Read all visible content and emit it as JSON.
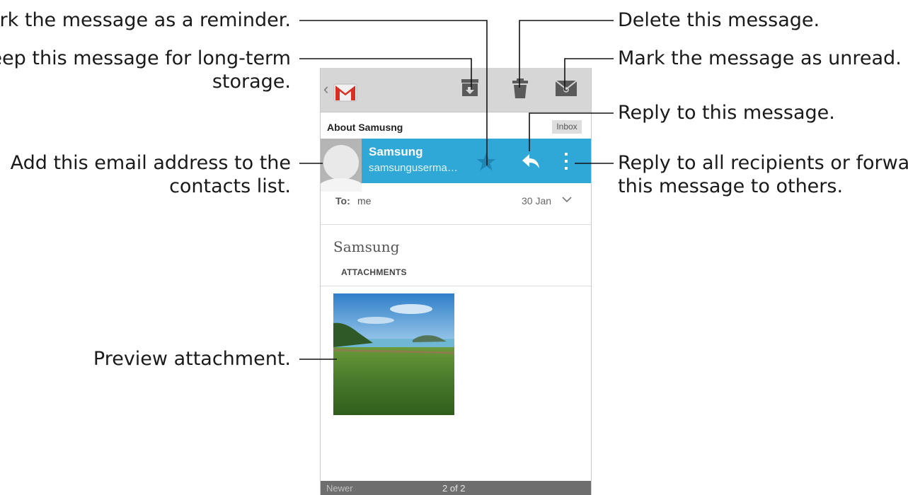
{
  "callouts": {
    "reminder": "Mark the message as a reminder.",
    "archive_line1": "Keep this message for long-term",
    "archive_line2": "storage.",
    "add_contact_line1": "Add this email address to the",
    "add_contact_line2": "contacts list.",
    "preview": "Preview attachment.",
    "delete": "Delete this message.",
    "unread": "Mark the message as unread.",
    "reply": "Reply to this message.",
    "reply_all_line1": "Reply to all recipients or forward",
    "reply_all_line2": "this message to others."
  },
  "action_bar": {
    "icons": [
      "back-chevron-icon",
      "gmail-logo-icon",
      "archive-icon",
      "trash-icon",
      "envelope-icon"
    ]
  },
  "message": {
    "subject": "About Samusng",
    "label": "Inbox",
    "sender_name": "Samsung",
    "sender_email": "samsunguserma…",
    "to_label": "To:",
    "to_value": "me",
    "date": "30 Jan",
    "body": "Samsung",
    "attachments_header": "ATTACHMENTS"
  },
  "bottom_bar": {
    "newer_label": "Newer",
    "page_counter": "2 of 2"
  },
  "colors": {
    "sender_bar": "#2fa8d8",
    "action_bar": "#d6d6d6",
    "gmail_red": "#d93025"
  }
}
